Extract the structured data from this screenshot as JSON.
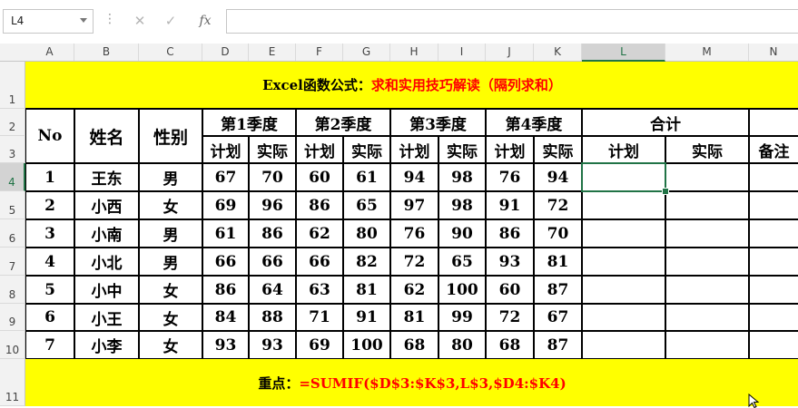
{
  "formula_bar": {
    "name_box": "L4",
    "cancel_icon": "✕",
    "enter_icon": "✓",
    "fx_label": "fx",
    "formula": ""
  },
  "columns": [
    "A",
    "B",
    "C",
    "D",
    "E",
    "F",
    "G",
    "H",
    "I",
    "J",
    "K",
    "L",
    "M",
    "N"
  ],
  "selected_cell": "L4",
  "rows": [
    "1",
    "2",
    "3",
    "4",
    "5",
    "6",
    "7",
    "8",
    "9",
    "10",
    "11"
  ],
  "title": {
    "black": "Excel函数公式：",
    "red": "求和实用技巧解读（隔列求和）"
  },
  "headers": {
    "no": "No",
    "name": "姓名",
    "gender": "性别",
    "quarters": [
      "第1季度",
      "第2季度",
      "第3季度",
      "第4季度"
    ],
    "plan": "计划",
    "actual": "实际",
    "total": "合计",
    "remark": "备注"
  },
  "data_rows": [
    {
      "no": "1",
      "name": "王东",
      "gender": "男",
      "values": [
        "67",
        "70",
        "60",
        "61",
        "94",
        "98",
        "76",
        "94"
      ]
    },
    {
      "no": "2",
      "name": "小西",
      "gender": "女",
      "values": [
        "69",
        "96",
        "86",
        "65",
        "97",
        "98",
        "91",
        "72"
      ]
    },
    {
      "no": "3",
      "name": "小南",
      "gender": "男",
      "values": [
        "61",
        "86",
        "62",
        "80",
        "76",
        "90",
        "86",
        "70"
      ]
    },
    {
      "no": "4",
      "name": "小北",
      "gender": "男",
      "values": [
        "66",
        "66",
        "66",
        "82",
        "72",
        "65",
        "93",
        "81"
      ]
    },
    {
      "no": "5",
      "name": "小中",
      "gender": "女",
      "values": [
        "86",
        "64",
        "63",
        "81",
        "62",
        "100",
        "60",
        "87"
      ]
    },
    {
      "no": "6",
      "name": "小王",
      "gender": "女",
      "values": [
        "84",
        "88",
        "71",
        "91",
        "81",
        "99",
        "72",
        "67"
      ]
    },
    {
      "no": "7",
      "name": "小李",
      "gender": "女",
      "values": [
        "93",
        "93",
        "69",
        "100",
        "68",
        "80",
        "68",
        "87"
      ]
    }
  ],
  "footer": {
    "black": "重点：",
    "red": "=SUMIF($D$3:$K$3,L$3,$D4:$K4)"
  },
  "colors": {
    "highlight": "#ffff00",
    "accent_red": "#ff0000",
    "excel_green": "#217346"
  }
}
